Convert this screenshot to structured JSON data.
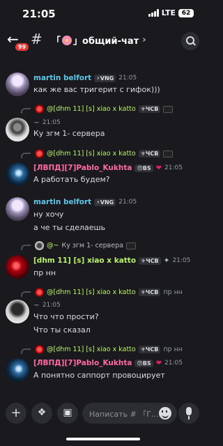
{
  "status": {
    "time": "21:05",
    "network": "LTE",
    "battery": "62"
  },
  "header": {
    "back_badge": "99",
    "channel_prefix": "「",
    "channel_name": "」общий-чат",
    "chevron": "›"
  },
  "messages": [
    {
      "author": "martin belfort",
      "role_tag": "⚡VNG",
      "time": "21:05",
      "lines": [
        "как же вас тригерит с гифок)))"
      ]
    },
    {
      "reply_author": "@[dhm 11] [s] xiao x katto",
      "reply_tag": "⚜ЧСВ",
      "reply_time": "21:05",
      "reply_prefix": "~",
      "lines": [
        "Ку згм 1- сервера"
      ]
    },
    {
      "reply_author": "@[dhm 11] [s] xiao x katto",
      "reply_tag": "⚜ЧСВ",
      "author_prefix": "[ЛВПД][7]",
      "author": "Pablo_Kukhta",
      "role_tag": "😠BS",
      "heart": "❤",
      "time": "21:05",
      "lines": [
        "А работать будем?"
      ]
    },
    {
      "author": "martin belfort",
      "role_tag": "⚡VNG",
      "time": "21:05",
      "lines": [
        "ну хочу",
        "а че ты сделаешь"
      ]
    },
    {
      "reply_author": "@~",
      "reply_text": "Ку згм 1- сервера",
      "author": "[dhm 11] [s] xiao x katto",
      "role_tag": "⚜ЧСВ",
      "time": "21:05",
      "lines": [
        "пр нн"
      ]
    },
    {
      "reply_author": "@[dhm 11] [s] xiao x katto",
      "reply_tag": "⚜ЧСВ",
      "reply_text": "пр нн",
      "reply_time": "21:05",
      "reply_prefix": "~",
      "lines": [
        "Что что прости?",
        "Что ты сказал"
      ]
    },
    {
      "reply_author": "@[dhm 11] [s] xiao x katto",
      "reply_tag": "⚜ЧСВ",
      "reply_text": "пр нн",
      "author_prefix": "[ЛВПД][7]",
      "author": "Pablo_Kukhta",
      "role_tag": "😠BS",
      "heart": "❤",
      "time": "21:05",
      "lines": [
        "А понятно саппорт провоцирует"
      ]
    }
  ],
  "composer": {
    "placeholder": "Написать # 「Г..."
  },
  "icons": [
    "back-arrow-icon",
    "hash-icon",
    "search-icon",
    "plus-icon",
    "apps-icon",
    "gift-icon",
    "emoji-icon",
    "mic-icon"
  ]
}
